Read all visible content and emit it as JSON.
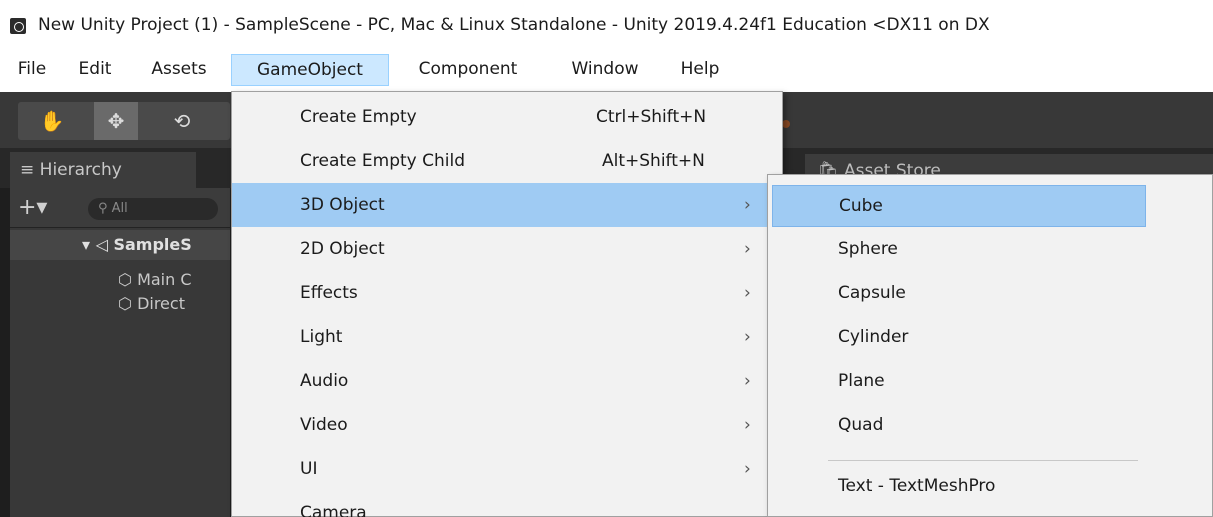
{
  "window": {
    "title": "New Unity Project (1) - SampleScene - PC, Mac & Linux Standalone - Unity 2019.4.24f1 Education <DX11 on DX"
  },
  "menubar": {
    "items": [
      {
        "label": "File"
      },
      {
        "label": "Edit"
      },
      {
        "label": "Assets"
      },
      {
        "label": "GameObject"
      },
      {
        "label": "Component"
      },
      {
        "label": "Window"
      },
      {
        "label": "Help"
      }
    ],
    "active": "GameObject"
  },
  "toolbar": {
    "tools": [
      {
        "icon": "hand-tool-icon",
        "glyph": "✋"
      },
      {
        "icon": "move-tool-icon",
        "glyph": "✥"
      },
      {
        "icon": "rotate-tool-icon",
        "glyph": "⟲"
      }
    ]
  },
  "tabs": {
    "hierarchy": "Hierarchy",
    "hierarchy_icon": "≡",
    "asset_store": "Asset Store",
    "asset_store_icon": "🛍"
  },
  "hierarchy": {
    "add_glyph": "+▾",
    "search_placeholder": "All",
    "scene": "SampleS",
    "objects": [
      "Main C",
      "Direct"
    ]
  },
  "gameobject_menu": {
    "items": [
      {
        "label": "Create Empty",
        "shortcut": "Ctrl+Shift+N",
        "arrow": ""
      },
      {
        "label": "Create Empty Child",
        "shortcut": "Alt+Shift+N",
        "arrow": ""
      },
      {
        "label": "3D Object",
        "shortcut": "",
        "arrow": "›"
      },
      {
        "label": "2D Object",
        "shortcut": "",
        "arrow": "›"
      },
      {
        "label": "Effects",
        "shortcut": "",
        "arrow": "›"
      },
      {
        "label": "Light",
        "shortcut": "",
        "arrow": "›"
      },
      {
        "label": "Audio",
        "shortcut": "",
        "arrow": "›"
      },
      {
        "label": "Video",
        "shortcut": "",
        "arrow": "›"
      },
      {
        "label": "UI",
        "shortcut": "",
        "arrow": "›"
      },
      {
        "label": "Camera",
        "shortcut": "",
        "arrow": ""
      }
    ],
    "highlighted": "3D Object"
  },
  "submenu_3d": {
    "items": [
      "Cube",
      "Sphere",
      "Capsule",
      "Cylinder",
      "Plane",
      "Quad",
      "Text - TextMeshPro"
    ],
    "highlighted": "Cube"
  },
  "colors": {
    "menu_highlight": "#9fcbf3",
    "menubar_active": "#cce8ff",
    "panel_dark": "#383838"
  }
}
